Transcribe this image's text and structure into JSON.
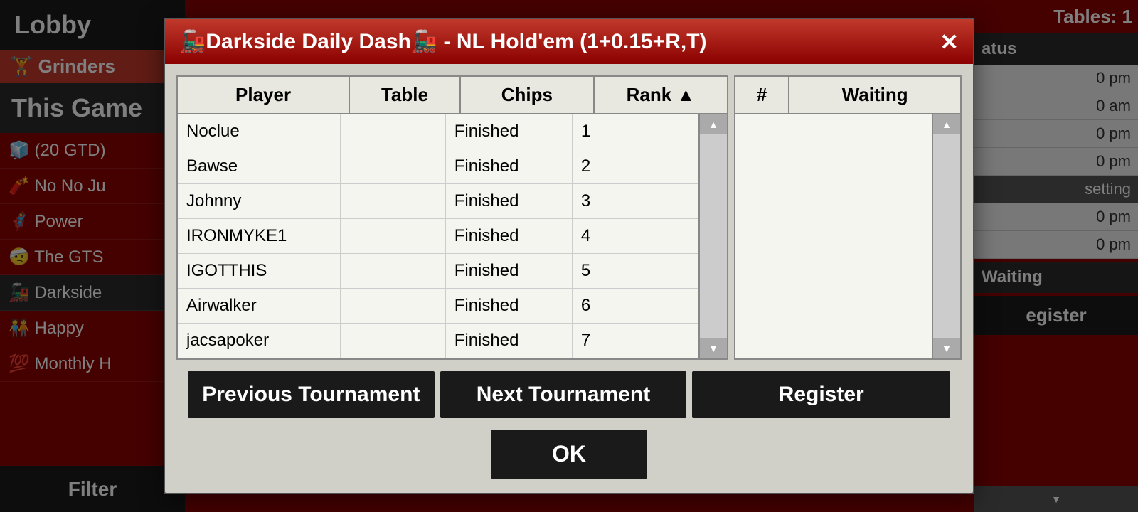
{
  "lobby": {
    "title": "Lobby",
    "section_header": "🏋 Grinders",
    "this_game_label": "This Game",
    "filter_btn": "Filter",
    "items": [
      {
        "emoji": "🧊",
        "label": "(20 GTD)"
      },
      {
        "emoji": "🧨",
        "label": "No No Ju"
      },
      {
        "emoji": "🦸‍♀️",
        "label": "Power"
      },
      {
        "emoji": "🤕",
        "label": "The GTS"
      },
      {
        "emoji": "🚂",
        "label": "Darkside",
        "selected": true
      },
      {
        "emoji": "🧑‍🤝‍🧑",
        "label": "Happy"
      },
      {
        "emoji": "💯",
        "label": "Monthly H"
      }
    ]
  },
  "right_panel": {
    "tables_label": "Tables: 1",
    "status_label": "atus",
    "waiting_label": "Waiting",
    "times": [
      {
        "time": "0 pm",
        "active": false
      },
      {
        "time": "0 am",
        "active": false
      },
      {
        "time": "0 pm",
        "active": false
      },
      {
        "time": "0 pm",
        "active": false
      },
      {
        "time": "setting",
        "active": true
      },
      {
        "time": "0 pm",
        "active": false
      },
      {
        "time": "0 pm",
        "active": false
      }
    ],
    "register_btn": "egister"
  },
  "modal": {
    "title": "🚂Darkside Daily Dash🚂 - NL Hold'em (1+0.15+R,T)",
    "close_btn": "✕",
    "table_headers": {
      "player": "Player",
      "table": "Table",
      "chips": "Chips",
      "rank": "Rank ▲",
      "num": "#",
      "waiting": "Waiting"
    },
    "players": [
      {
        "name": "Noclue",
        "table": "",
        "chips": "Finished",
        "rank": "1"
      },
      {
        "name": "Bawse",
        "table": "",
        "chips": "Finished",
        "rank": "2"
      },
      {
        "name": "Johnny",
        "table": "",
        "chips": "Finished",
        "rank": "3"
      },
      {
        "name": "IRONMYKE1",
        "table": "",
        "chips": "Finished",
        "rank": "4"
      },
      {
        "name": "IGOTTHIS",
        "table": "",
        "chips": "Finished",
        "rank": "5"
      },
      {
        "name": "Airwalker",
        "table": "",
        "chips": "Finished",
        "rank": "6"
      },
      {
        "name": "jacsapoker",
        "table": "",
        "chips": "Finished",
        "rank": "7"
      }
    ],
    "waiting_players": [],
    "buttons": {
      "prev": "Previous Tournament",
      "next": "Next Tournament",
      "register": "Register",
      "ok": "OK"
    }
  }
}
